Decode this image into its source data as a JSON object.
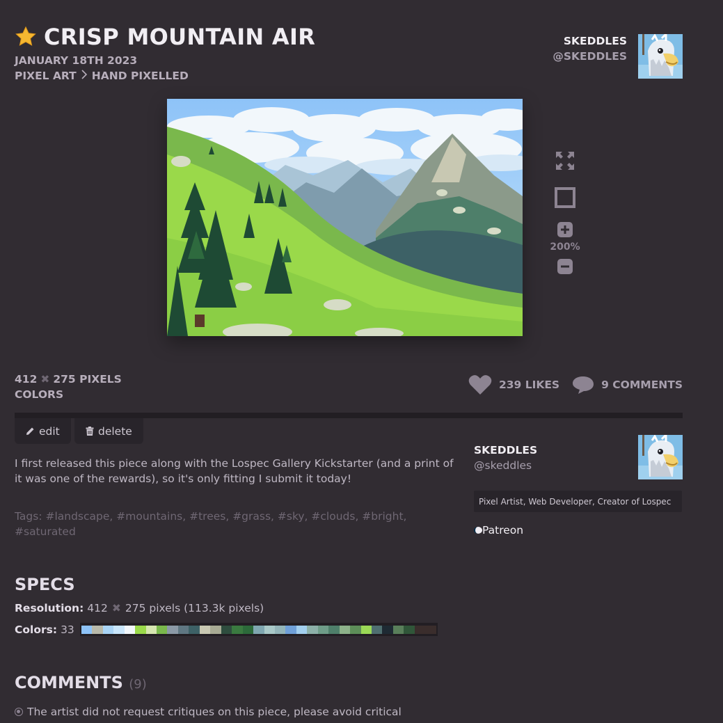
{
  "artwork": {
    "title": "CRISP MOUNTAIN AIR",
    "date": "JANUARY 18TH 2023",
    "breadcrumb": [
      "PIXEL ART",
      "HAND PIXELLED"
    ],
    "artist_name": "SKEDDLES",
    "artist_handle": "@SKEDDLES"
  },
  "viewer": {
    "zoom": "200%",
    "icons": [
      "fullscreen-icon",
      "fit-frame-icon",
      "zoom-in-icon",
      "zoom-out-icon"
    ]
  },
  "info": {
    "width": "412",
    "height": "275",
    "pixels_unit": "PIXELS",
    "colors_label": "COLORS",
    "likes": "239 LIKES",
    "comments": "9 COMMENTS"
  },
  "actions": {
    "edit_label": "edit",
    "delete_label": "delete"
  },
  "description": "I first released this piece along with the Lospec Gallery Kickstarter (and a print of it was one of the rewards), so it's only fitting I submit it today!",
  "tags": "Tags: #landscape, #mountains, #trees, #grass, #sky, #clouds, #bright, #saturated",
  "artist_card": {
    "name": "SKEDDLES",
    "handle": "@skeddles",
    "bio": "Pixel Artist, Web Developer, Creator of Lospec",
    "link": "Patreon"
  },
  "specs": {
    "heading": "SPECS",
    "resolution_label": "Resolution:",
    "resolution_w": "412",
    "resolution_rest": "275 pixels (113.3k pixels)",
    "colors_label": "Colors:",
    "colors_count": "33",
    "palette": [
      "#8ec3f8",
      "#b8b9aa",
      "#a9d4f5",
      "#c9e6fb",
      "#f2f7fb",
      "#9ad94a",
      "#d6e6b0",
      "#7ab84c",
      "#8b99a6",
      "#5f7782",
      "#3d6166",
      "#c8c8b2",
      "#a8ab94",
      "#2e4d3e",
      "#3a7a40",
      "#2c6a3a",
      "#7fa7b0",
      "#a9c9c8",
      "#93b5b9",
      "#6fa0d8",
      "#a2cfee",
      "#8cb0a8",
      "#6e9c88",
      "#4e7f6a",
      "#8db28a",
      "#5d8e58",
      "#9bd956",
      "#4f6f70",
      "#1e2a33",
      "#597f5a",
      "#305639",
      "#3a2d2c",
      "#3a2d2c"
    ]
  },
  "comments": {
    "heading": "COMMENTS",
    "count": "(9)",
    "notice": "The artist did not request critiques on this piece, please avoid critical"
  },
  "colors": {
    "background": "#312c32",
    "panel": "#28242a",
    "accent_star": "#f5b731"
  }
}
